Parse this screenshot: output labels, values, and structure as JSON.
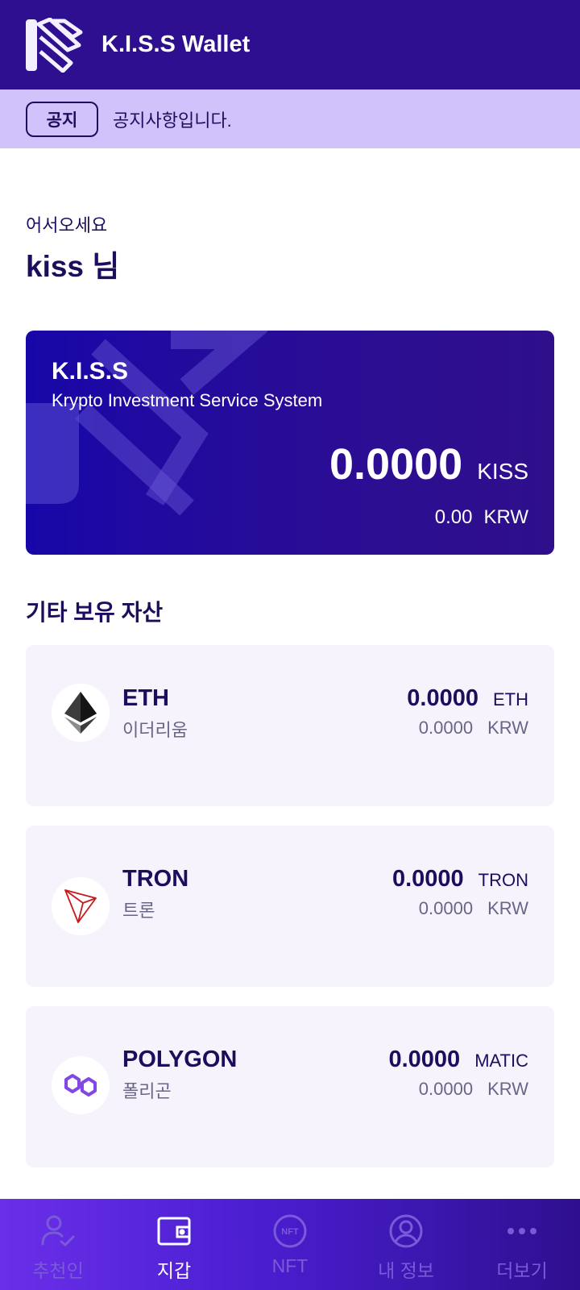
{
  "header": {
    "title": "K.I.S.S Wallet"
  },
  "notice": {
    "tag": "공지",
    "text": "공지사항입니다."
  },
  "greeting": {
    "line1": "어서오세요",
    "name": "kiss 님"
  },
  "main_card": {
    "brand": "K.I.S.S",
    "subtitle": "Krypto Investment Service System",
    "balance": "0.0000",
    "balance_unit": "KISS",
    "krw_value": "0.00",
    "krw_unit": "KRW"
  },
  "assets_section": {
    "title": "기타 보유 자산",
    "items": [
      {
        "name": "ETH",
        "kor_name": "이더리움",
        "amount": "0.0000",
        "unit": "ETH",
        "krw": "0.0000",
        "krw_unit": "KRW",
        "icon": "ethereum-icon"
      },
      {
        "name": "TRON",
        "kor_name": "트론",
        "amount": "0.0000",
        "unit": "TRON",
        "krw": "0.0000",
        "krw_unit": "KRW",
        "icon": "tron-icon"
      },
      {
        "name": "POLYGON",
        "kor_name": "폴리곤",
        "amount": "0.0000",
        "unit": "MATIC",
        "krw": "0.0000",
        "krw_unit": "KRW",
        "icon": "polygon-icon"
      }
    ]
  },
  "bottom_nav": {
    "items": [
      {
        "label": "추천인",
        "icon": "person-check-icon",
        "active": false
      },
      {
        "label": "지갑",
        "icon": "wallet-icon",
        "active": true
      },
      {
        "label": "NFT",
        "icon": "nft-icon",
        "active": false
      },
      {
        "label": "내 정보",
        "icon": "profile-icon",
        "active": false
      },
      {
        "label": "더보기",
        "icon": "more-icon",
        "active": false
      }
    ]
  },
  "colors": {
    "header_bg": "#2e0f8f",
    "notice_bg": "#d0c2fb",
    "text_primary": "#1e0d5c",
    "card_bg": "#f6f3fd"
  }
}
